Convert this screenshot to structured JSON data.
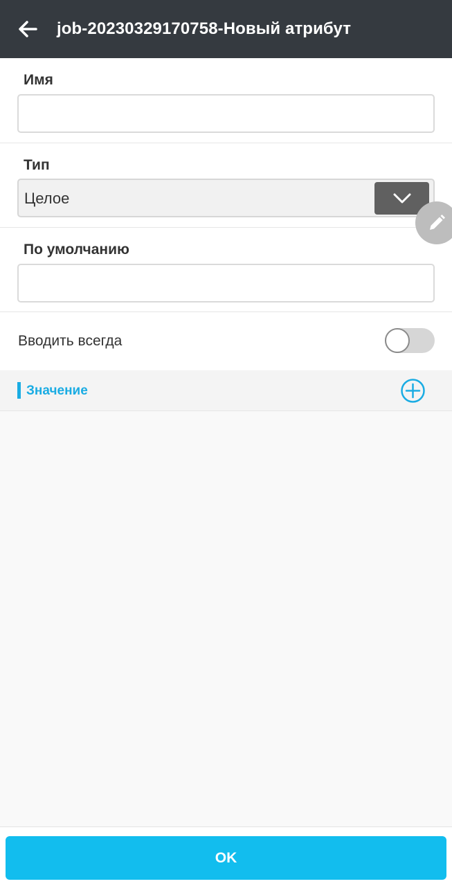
{
  "header": {
    "title": "job-20230329170758-Новый атрибут",
    "back_icon": "arrow-left-icon"
  },
  "form": {
    "name": {
      "label": "Имя",
      "value": "",
      "placeholder": ""
    },
    "type": {
      "label": "Тип",
      "selected": "Целое",
      "arrow_icon": "chevron-down-icon"
    },
    "default": {
      "label": "По умолчанию",
      "value": "",
      "placeholder": ""
    },
    "always_input": {
      "label": "Вводить всегда",
      "checked": false
    }
  },
  "fab": {
    "icon": "pencil-icon"
  },
  "values_section": {
    "title": "Значение",
    "add_icon": "plus-circle-icon"
  },
  "footer": {
    "ok_label": "OK"
  },
  "colors": {
    "header_bg": "#353a40",
    "accent": "#1aace3",
    "ok_button": "#12bdee"
  }
}
